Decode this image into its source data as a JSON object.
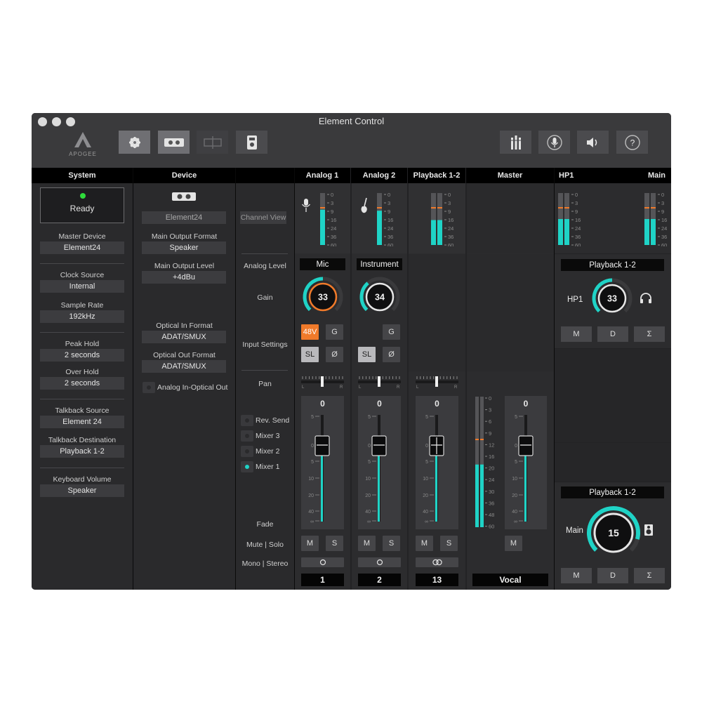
{
  "window": {
    "title": "Element Control"
  },
  "toolbar": {
    "logo_text": "APOGEE"
  },
  "headers": {
    "system": "System",
    "device": "Device",
    "analog1": "Analog 1",
    "analog2": "Analog 2",
    "playback": "Playback 1-2",
    "master": "Master",
    "hp1": "HP1",
    "main": "Main"
  },
  "system": {
    "status": "Ready",
    "master_device_label": "Master Device",
    "master_device": "Element24",
    "clock_source_label": "Clock Source",
    "clock_source": "Internal",
    "sample_rate_label": "Sample Rate",
    "sample_rate": "192kHz",
    "peak_hold_label": "Peak Hold",
    "peak_hold": "2 seconds",
    "over_hold_label": "Over Hold",
    "over_hold": "2 seconds",
    "talkback_source_label": "Talkback Source",
    "talkback_source": "Element 24",
    "talkback_dest_label": "Talkback Destination",
    "talkback_dest": "Playback 1-2",
    "keyboard_volume_label": "Keyboard Volume",
    "keyboard_volume": "Speaker"
  },
  "device": {
    "name": "Element24",
    "main_output_format_label": "Main Output Format",
    "main_output_format": "Speaker",
    "main_output_level_label": "Main Output Level",
    "main_output_level": "+4dBu",
    "optical_in_label": "Optical In Format",
    "optical_in": "ADAT/SMUX",
    "optical_out_label": "Optical Out Format",
    "optical_out": "ADAT/SMUX",
    "analog_in_optical_out": "Analog In-Optical Out"
  },
  "labels": {
    "channel_view": "Channel View",
    "analog_level": "Analog Level",
    "gain": "Gain",
    "input_settings": "Input Settings",
    "pan": "Pan",
    "rev_send": "Rev. Send",
    "mixer3": "Mixer 3",
    "mixer2": "Mixer 2",
    "mixer1": "Mixer 1",
    "fade": "Fade",
    "mute_solo": "Mute | Solo",
    "mono_stereo": "Mono | Stereo"
  },
  "meter_scale": [
    "0",
    "3",
    "9",
    "16",
    "24",
    "36",
    "60"
  ],
  "fader_scale": [
    "5",
    "0",
    "5",
    "10",
    "20",
    "40",
    "∞"
  ],
  "master_scale": [
    "0",
    "3",
    "6",
    "9",
    "12",
    "16",
    "20",
    "24",
    "30",
    "36",
    "48",
    "60"
  ],
  "channels": {
    "a1": {
      "level": "Mic",
      "gain": "33",
      "b48v": "48V",
      "g": "G",
      "sl": "SL",
      "phase": "Ø",
      "fader": "0",
      "m": "M",
      "s": "S",
      "name": "1",
      "meter": 0.68
    },
    "a2": {
      "level": "Instrument",
      "gain": "34",
      "g": "G",
      "sl": "SL",
      "phase": "Ø",
      "fader": "0",
      "m": "M",
      "s": "S",
      "name": "2",
      "meter": 0.66
    },
    "pb": {
      "fader": "0",
      "m": "M",
      "s": "S",
      "name": "13",
      "meter": 0.48
    },
    "master": {
      "fader": "0",
      "m": "M",
      "name": "Vocal",
      "meter": 0.48
    }
  },
  "outputs": {
    "hp1": {
      "source": "Playback 1-2",
      "label": "HP1",
      "value": "33",
      "m": "M",
      "d": "D",
      "sum": "Σ",
      "meter": 0.5
    },
    "main": {
      "source": "Playback 1-2",
      "label": "Main",
      "value": "15",
      "m": "M",
      "d": "D",
      "sum": "Σ",
      "meter": 0.5
    }
  },
  "colors": {
    "accent": "#1fd3c6",
    "orange": "#f07a2a",
    "peak": "#f07a2a"
  }
}
